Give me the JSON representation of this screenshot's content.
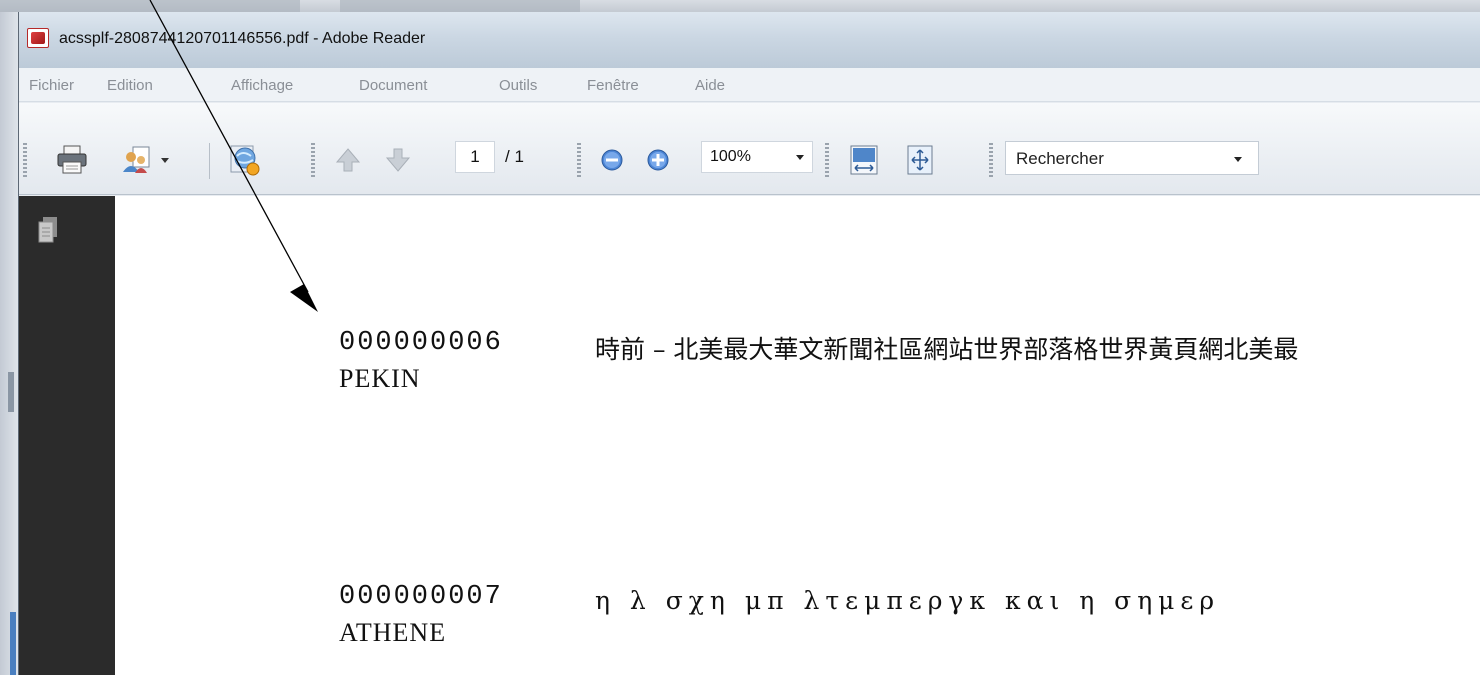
{
  "window": {
    "title": "acssplf-2808744120701146556.pdf - Adobe Reader"
  },
  "menu": [
    "Fichier",
    "Edition",
    "Affichage",
    "Document",
    "Outils",
    "Fenêtre",
    "Aide"
  ],
  "toolbar": {
    "page_current": "1",
    "page_total": "/ 1",
    "zoom": "100%",
    "search_placeholder": "Rechercher"
  },
  "document": {
    "records": [
      {
        "id": "000000006",
        "city": "PEKIN",
        "text": "時前 – 北美最大華文新聞社區網站世界部落格世界黃頁網北美最"
      },
      {
        "id": "000000007",
        "city": "ATHENE",
        "text": "η λ  σχη μπ  λτεμπεργκ και η σημερ"
      }
    ]
  }
}
